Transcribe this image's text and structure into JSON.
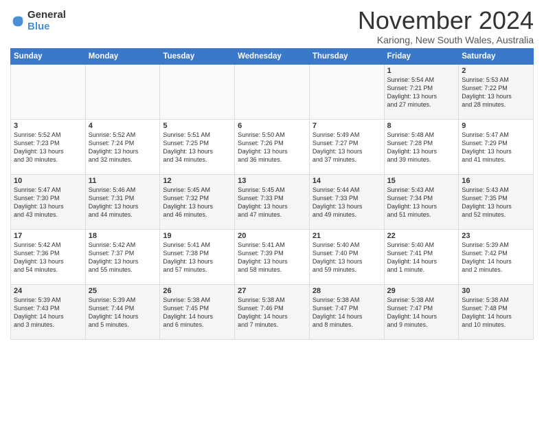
{
  "logo": {
    "general": "General",
    "blue": "Blue"
  },
  "title": "November 2024",
  "location": "Kariong, New South Wales, Australia",
  "days_of_week": [
    "Sunday",
    "Monday",
    "Tuesday",
    "Wednesday",
    "Thursday",
    "Friday",
    "Saturday"
  ],
  "weeks": [
    [
      {
        "day": "",
        "info": ""
      },
      {
        "day": "",
        "info": ""
      },
      {
        "day": "",
        "info": ""
      },
      {
        "day": "",
        "info": ""
      },
      {
        "day": "",
        "info": ""
      },
      {
        "day": "1",
        "info": "Sunrise: 5:54 AM\nSunset: 7:21 PM\nDaylight: 13 hours\nand 27 minutes."
      },
      {
        "day": "2",
        "info": "Sunrise: 5:53 AM\nSunset: 7:22 PM\nDaylight: 13 hours\nand 28 minutes."
      }
    ],
    [
      {
        "day": "3",
        "info": "Sunrise: 5:52 AM\nSunset: 7:23 PM\nDaylight: 13 hours\nand 30 minutes."
      },
      {
        "day": "4",
        "info": "Sunrise: 5:52 AM\nSunset: 7:24 PM\nDaylight: 13 hours\nand 32 minutes."
      },
      {
        "day": "5",
        "info": "Sunrise: 5:51 AM\nSunset: 7:25 PM\nDaylight: 13 hours\nand 34 minutes."
      },
      {
        "day": "6",
        "info": "Sunrise: 5:50 AM\nSunset: 7:26 PM\nDaylight: 13 hours\nand 36 minutes."
      },
      {
        "day": "7",
        "info": "Sunrise: 5:49 AM\nSunset: 7:27 PM\nDaylight: 13 hours\nand 37 minutes."
      },
      {
        "day": "8",
        "info": "Sunrise: 5:48 AM\nSunset: 7:28 PM\nDaylight: 13 hours\nand 39 minutes."
      },
      {
        "day": "9",
        "info": "Sunrise: 5:47 AM\nSunset: 7:29 PM\nDaylight: 13 hours\nand 41 minutes."
      }
    ],
    [
      {
        "day": "10",
        "info": "Sunrise: 5:47 AM\nSunset: 7:30 PM\nDaylight: 13 hours\nand 43 minutes."
      },
      {
        "day": "11",
        "info": "Sunrise: 5:46 AM\nSunset: 7:31 PM\nDaylight: 13 hours\nand 44 minutes."
      },
      {
        "day": "12",
        "info": "Sunrise: 5:45 AM\nSunset: 7:32 PM\nDaylight: 13 hours\nand 46 minutes."
      },
      {
        "day": "13",
        "info": "Sunrise: 5:45 AM\nSunset: 7:33 PM\nDaylight: 13 hours\nand 47 minutes."
      },
      {
        "day": "14",
        "info": "Sunrise: 5:44 AM\nSunset: 7:33 PM\nDaylight: 13 hours\nand 49 minutes."
      },
      {
        "day": "15",
        "info": "Sunrise: 5:43 AM\nSunset: 7:34 PM\nDaylight: 13 hours\nand 51 minutes."
      },
      {
        "day": "16",
        "info": "Sunrise: 5:43 AM\nSunset: 7:35 PM\nDaylight: 13 hours\nand 52 minutes."
      }
    ],
    [
      {
        "day": "17",
        "info": "Sunrise: 5:42 AM\nSunset: 7:36 PM\nDaylight: 13 hours\nand 54 minutes."
      },
      {
        "day": "18",
        "info": "Sunrise: 5:42 AM\nSunset: 7:37 PM\nDaylight: 13 hours\nand 55 minutes."
      },
      {
        "day": "19",
        "info": "Sunrise: 5:41 AM\nSunset: 7:38 PM\nDaylight: 13 hours\nand 57 minutes."
      },
      {
        "day": "20",
        "info": "Sunrise: 5:41 AM\nSunset: 7:39 PM\nDaylight: 13 hours\nand 58 minutes."
      },
      {
        "day": "21",
        "info": "Sunrise: 5:40 AM\nSunset: 7:40 PM\nDaylight: 13 hours\nand 59 minutes."
      },
      {
        "day": "22",
        "info": "Sunrise: 5:40 AM\nSunset: 7:41 PM\nDaylight: 14 hours\nand 1 minute."
      },
      {
        "day": "23",
        "info": "Sunrise: 5:39 AM\nSunset: 7:42 PM\nDaylight: 14 hours\nand 2 minutes."
      }
    ],
    [
      {
        "day": "24",
        "info": "Sunrise: 5:39 AM\nSunset: 7:43 PM\nDaylight: 14 hours\nand 3 minutes."
      },
      {
        "day": "25",
        "info": "Sunrise: 5:39 AM\nSunset: 7:44 PM\nDaylight: 14 hours\nand 5 minutes."
      },
      {
        "day": "26",
        "info": "Sunrise: 5:38 AM\nSunset: 7:45 PM\nDaylight: 14 hours\nand 6 minutes."
      },
      {
        "day": "27",
        "info": "Sunrise: 5:38 AM\nSunset: 7:46 PM\nDaylight: 14 hours\nand 7 minutes."
      },
      {
        "day": "28",
        "info": "Sunrise: 5:38 AM\nSunset: 7:47 PM\nDaylight: 14 hours\nand 8 minutes."
      },
      {
        "day": "29",
        "info": "Sunrise: 5:38 AM\nSunset: 7:47 PM\nDaylight: 14 hours\nand 9 minutes."
      },
      {
        "day": "30",
        "info": "Sunrise: 5:38 AM\nSunset: 7:48 PM\nDaylight: 14 hours\nand 10 minutes."
      }
    ]
  ]
}
